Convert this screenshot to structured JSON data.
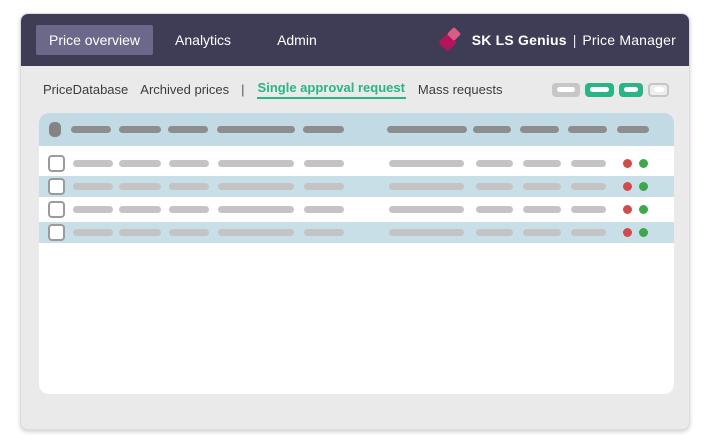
{
  "topnav": {
    "tabs": [
      {
        "label": "Price overview",
        "active": true
      },
      {
        "label": "Analytics",
        "active": false
      },
      {
        "label": "Admin",
        "active": false
      }
    ],
    "brand": {
      "logo_icon": "double-diamond-icon",
      "name": "SK LS Genius",
      "separator": "|",
      "product": "Price Manager"
    }
  },
  "subnav": {
    "links": [
      {
        "label": "PriceDatabase",
        "active": false
      },
      {
        "label": "Archived prices",
        "active": false
      },
      {
        "label": "Single approval request",
        "active": true
      },
      {
        "label": "Mass requests",
        "active": false
      }
    ],
    "separator": "|",
    "toolbar": [
      {
        "name": "action-button-1",
        "variant": "gray"
      },
      {
        "name": "action-button-2",
        "variant": "green"
      },
      {
        "name": "action-button-3",
        "variant": "green"
      },
      {
        "name": "action-button-4",
        "variant": "outline"
      }
    ]
  },
  "table": {
    "header": {
      "select_all_placeholder": true,
      "skeleton_columns": 10
    },
    "rows": [
      {
        "shaded": false,
        "checked": false,
        "status_dots": [
          "red",
          "green"
        ]
      },
      {
        "shaded": true,
        "checked": false,
        "status_dots": [
          "red",
          "green"
        ]
      },
      {
        "shaded": false,
        "checked": false,
        "status_dots": [
          "red",
          "green"
        ]
      },
      {
        "shaded": true,
        "checked": false,
        "status_dots": [
          "red",
          "green"
        ]
      }
    ]
  },
  "colors": {
    "navbar": "#3f3c55",
    "active_tab": "#6b688a",
    "accent_green": "#2ab487",
    "table_blue": "#c2dae4",
    "row_blue": "#c9dfe8",
    "dot_red": "#d14b4d",
    "dot_green": "#3ea64b",
    "brand_pink_dark": "#b6145a",
    "brand_pink_light": "#e05f88"
  }
}
